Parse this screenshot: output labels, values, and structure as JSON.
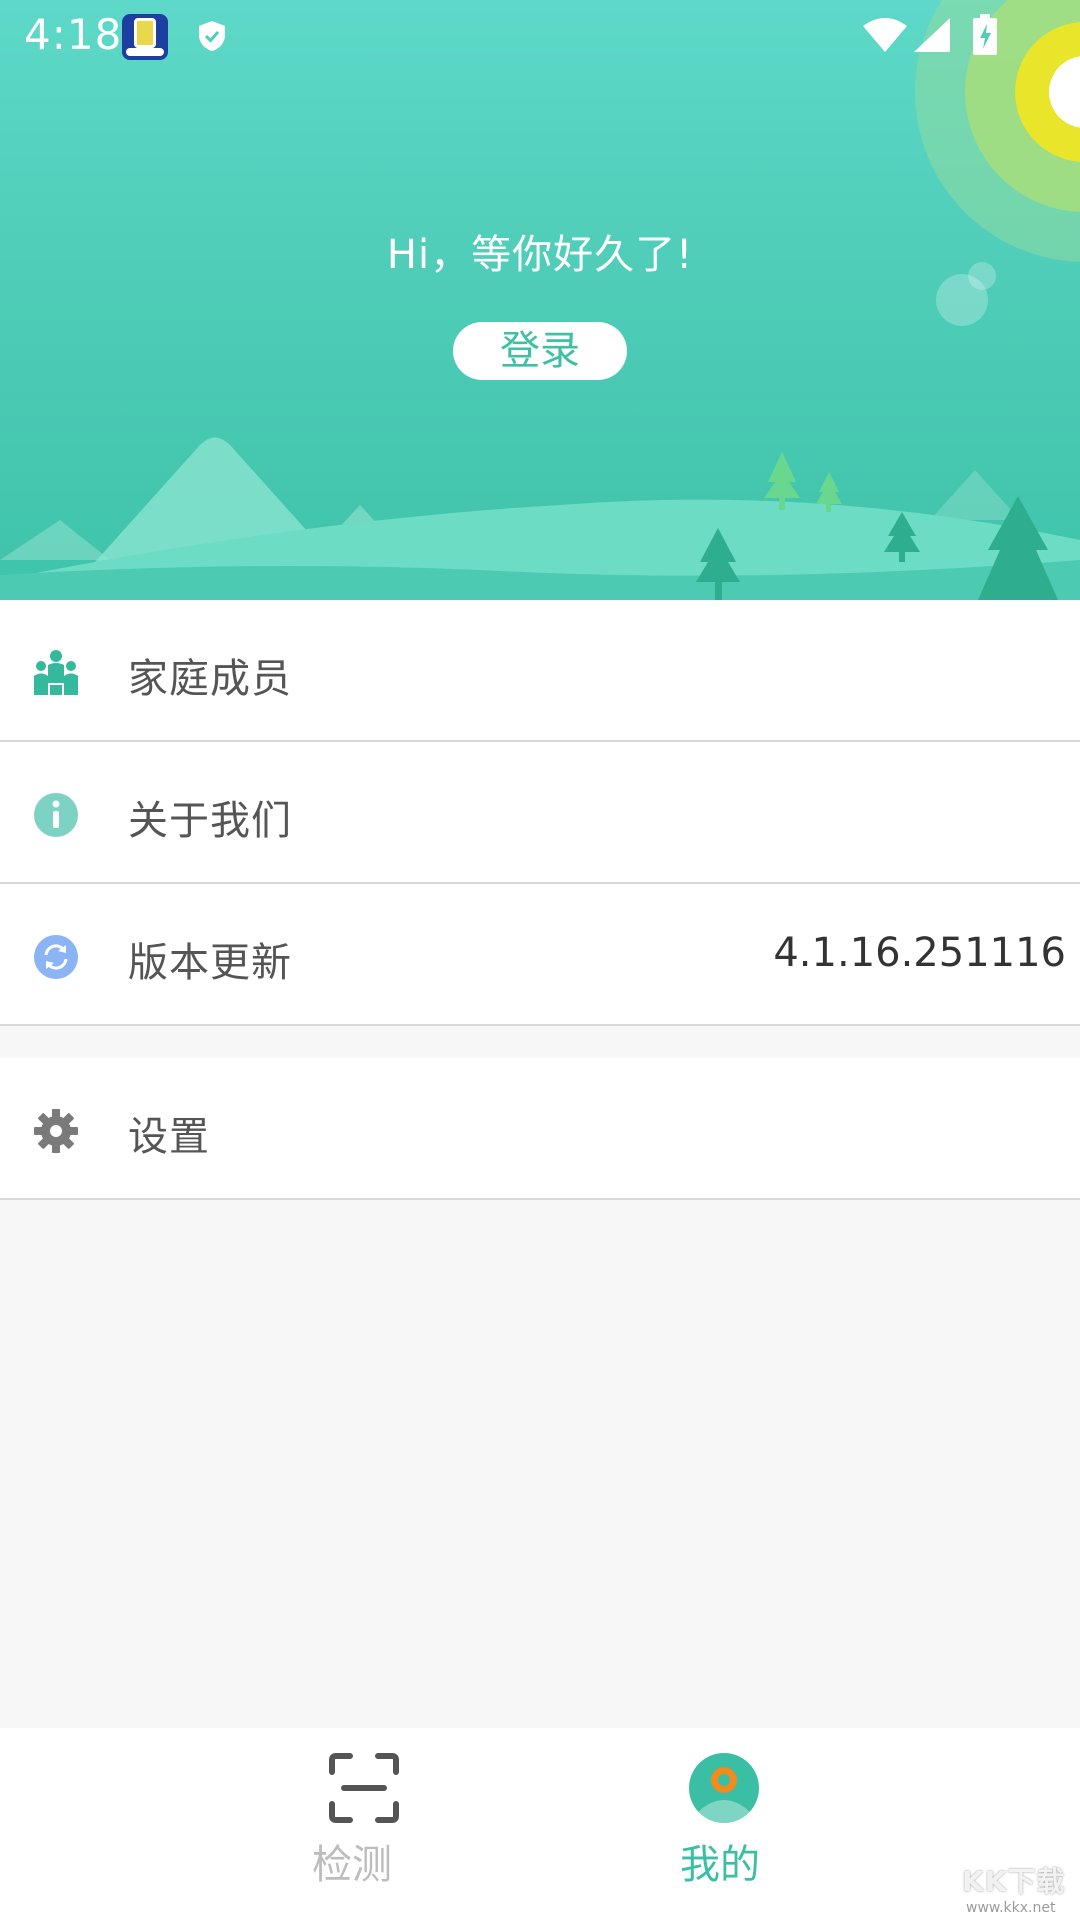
{
  "status_bar": {
    "time": "4:18",
    "icons": [
      "app-notification-icon",
      "shield-icon",
      "wifi-icon",
      "cell-signal-icon",
      "battery-charging-icon"
    ]
  },
  "header": {
    "greeting": "Hi，等你好久了!",
    "login_label": "登录",
    "accent_color": "#4fcdb8"
  },
  "menu": {
    "items": [
      {
        "label": "家庭成员",
        "icon": "family-members-icon"
      },
      {
        "label": "关于我们",
        "icon": "info-icon"
      },
      {
        "label": "版本更新",
        "icon": "refresh-icon",
        "value": "4.1.16.251116"
      },
      {
        "label": "设置",
        "icon": "gear-icon"
      }
    ]
  },
  "bottom_nav": {
    "items": [
      {
        "label": "检测",
        "icon": "scan-icon",
        "active": false
      },
      {
        "label": "我的",
        "icon": "profile-icon",
        "active": true
      }
    ],
    "active_color": "#3bbfa4",
    "inactive_color": "#bdbdbd"
  },
  "watermark": {
    "main": "KK下载",
    "sub": "www.kkx.net"
  }
}
